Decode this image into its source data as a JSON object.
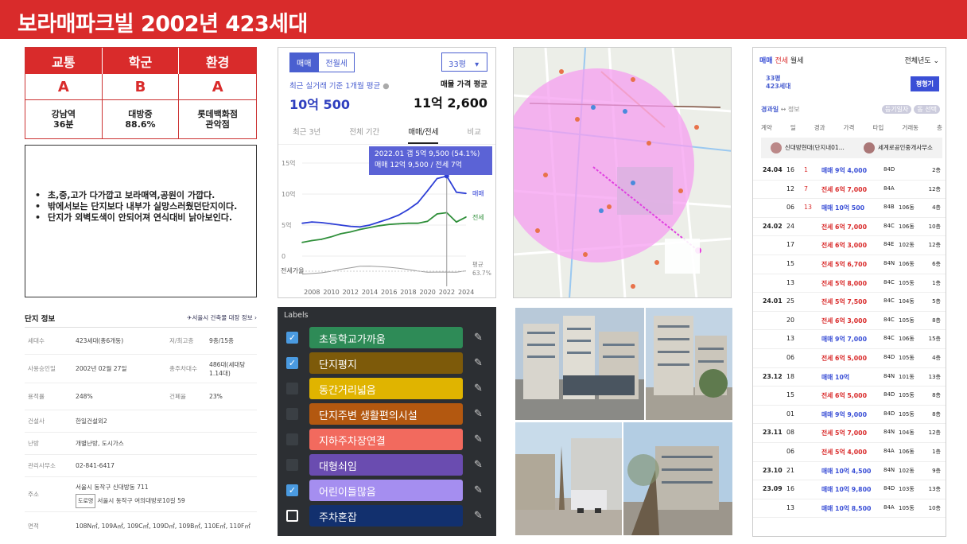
{
  "title": "보라매파크빌  2002년 423세대",
  "grade": {
    "headers": [
      "교통",
      "학군",
      "환경"
    ],
    "grades": [
      "A",
      "B",
      "A"
    ],
    "details": [
      "강남역\n36분",
      "대방중\n88.6%",
      "롯데백화점\n관악점"
    ]
  },
  "notes": [
    "초,중,고가 다가깝고 보라매역,공원이 가깝다.",
    "밖에서보는 단지보다 내부가 실망스러웠던단지이다.",
    "단지가 외벽도색이 안되어져 연식대비 낡아보인다."
  ],
  "info": {
    "title": "단지 정보",
    "link": "서울시 건축물 대장 정보",
    "rows": [
      {
        "k": "세대수",
        "v": "423세대(총6개동)",
        "k2": "저/최고층",
        "v2": "9층/15층"
      },
      {
        "k": "사용승인일",
        "v": "2002년 02월 27일",
        "k2": "총주차대수",
        "v2": "486대(세대당 1.14대)"
      },
      {
        "k": "용적률",
        "v": "248%",
        "k2": "건폐율",
        "v2": "23%"
      },
      {
        "k": "건설사",
        "v": "한일건설외2"
      },
      {
        "k": "난방",
        "v": "개별난방, 도시가스"
      },
      {
        "k": "관리사무소",
        "v": "02-841-6417"
      },
      {
        "k": "주소",
        "v": "서울시 동작구 신대방동 711",
        "tag": "도로명",
        "v3": "서울시 동작구 여의대방로10길 59"
      },
      {
        "k": "면적",
        "v": "108N㎡, 109A㎡, 109C㎡, 109D㎡, 109B㎡, 110E㎡, 110F㎡"
      }
    ]
  },
  "price": {
    "seg_on": "매매",
    "seg_off": "전월세",
    "size": "33평",
    "recent_label": "최근 실거래 기준 1개월 평균",
    "recent_value": "10억 500",
    "ask_label": "매물 가격 평균",
    "ask_value": "11억 2,600",
    "tabs": [
      "최근 3년",
      "전체 기간",
      "매매/전세",
      "비교"
    ],
    "tooltip1": "2022.01  갭 5억 9,500 (54.1%)",
    "tooltip2": "매매 12억 9,500 / 전세 7억",
    "lbl_sale": "매매",
    "lbl_lease": "전세",
    "lbl_ratio": "전세가율",
    "lbl_avg": "평균",
    "lbl_avg_v": "63.7%"
  },
  "chart_data": {
    "type": "line",
    "x": [
      2007,
      2008,
      2009,
      2010,
      2011,
      2012,
      2013,
      2014,
      2015,
      2016,
      2017,
      2018,
      2019,
      2020,
      2021,
      2022,
      2023,
      2024
    ],
    "series": [
      {
        "name": "매매",
        "values": [
          5.3,
          5.5,
          5.4,
          5.2,
          5.0,
          4.8,
          4.7,
          5.0,
          5.5,
          6.0,
          6.6,
          7.5,
          8.6,
          10.5,
          12.5,
          12.9,
          10.3,
          10.1
        ]
      },
      {
        "name": "전세",
        "values": [
          2.2,
          2.5,
          2.7,
          3.1,
          3.6,
          3.9,
          4.3,
          4.6,
          4.9,
          5.1,
          5.2,
          5.3,
          5.3,
          5.6,
          6.8,
          7.0,
          5.5,
          6.3
        ]
      }
    ],
    "yticks": [
      "0",
      "5억",
      "10억",
      "15억"
    ],
    "xticks": [
      "2008",
      "2010",
      "2012",
      "2014",
      "2016",
      "2018",
      "2020",
      "2022",
      "2024"
    ],
    "ylim": [
      0,
      15
    ],
    "highlight_x": 2022
  },
  "labels": {
    "title": "Labels",
    "items": [
      {
        "text": "초등학교가까움",
        "color": "#2e8b57",
        "checked": true
      },
      {
        "text": "단지평지",
        "color": "#7d5a0a",
        "checked": true
      },
      {
        "text": "동간거리넓음",
        "color": "#e0b400",
        "checked": false
      },
      {
        "text": "단지주변 생활편의시설",
        "color": "#b35810",
        "checked": false
      },
      {
        "text": "지하주차장연결",
        "color": "#f26a5e",
        "checked": false
      },
      {
        "text": "대형쇠임",
        "color": "#6a4cb0",
        "checked": false
      },
      {
        "text": "어린이들많음",
        "color": "#a58ef0",
        "checked": true
      },
      {
        "text": "주차혼잡",
        "color": "#12306e",
        "checked": false
      }
    ]
  },
  "listing": {
    "tab1": "매매",
    "tab2": "전세",
    "tab3": "월세",
    "filter": "전체년도",
    "apt": "33평\n423세대",
    "btn": "평형기",
    "sub_a": "경과일",
    "sub_b": "↔ 정보",
    "btn_a": "등기일자",
    "btn_b": "동 선택",
    "cols": [
      "계약",
      "일",
      "경과",
      "가격",
      "타입",
      "거래동",
      "층"
    ],
    "agent1": "신대방현대(단지내01...",
    "agent2": "세계로공인중개사무소",
    "rows": [
      {
        "ym": "24.04",
        "d": "16",
        "f": "1",
        "p": "매매 9억 4,000",
        "s": "sale",
        "t": "84D",
        "b": "",
        "fl": "2층"
      },
      {
        "ym": "",
        "d": "12",
        "f": "7",
        "p": "전세 6억 7,000",
        "s": "lease",
        "t": "84A",
        "b": "",
        "fl": "12층"
      },
      {
        "ym": "",
        "d": "06",
        "f": "13",
        "p": "매매 10억 500",
        "s": "sale",
        "t": "84B",
        "b": "106동",
        "fl": "4층"
      },
      {
        "ym": "24.02",
        "d": "24",
        "f": "",
        "p": "전세 6억 7,000",
        "s": "lease",
        "t": "84C",
        "b": "106동",
        "fl": "10층"
      },
      {
        "ym": "",
        "d": "17",
        "f": "",
        "p": "전세 6억 3,000",
        "s": "lease",
        "t": "84E",
        "b": "102동",
        "fl": "12층"
      },
      {
        "ym": "",
        "d": "15",
        "f": "",
        "p": "전세 5억 6,700",
        "s": "lease",
        "t": "84N",
        "b": "106동",
        "fl": "6층"
      },
      {
        "ym": "",
        "d": "13",
        "f": "",
        "p": "전세 5억 8,000",
        "s": "lease",
        "t": "84C",
        "b": "105동",
        "fl": "1층"
      },
      {
        "ym": "24.01",
        "d": "25",
        "f": "",
        "p": "전세 5억 7,500",
        "s": "lease",
        "t": "84C",
        "b": "104동",
        "fl": "5층"
      },
      {
        "ym": "",
        "d": "20",
        "f": "",
        "p": "전세 6억 3,000",
        "s": "lease",
        "t": "84C",
        "b": "105동",
        "fl": "8층"
      },
      {
        "ym": "",
        "d": "13",
        "f": "",
        "p": "매매 9억 7,000",
        "s": "sale",
        "t": "84C",
        "b": "106동",
        "fl": "15층"
      },
      {
        "ym": "",
        "d": "06",
        "f": "",
        "p": "전세 6억 5,000",
        "s": "lease",
        "t": "84D",
        "b": "105동",
        "fl": "4층"
      },
      {
        "ym": "23.12",
        "d": "18",
        "f": "",
        "p": "매매 10억",
        "s": "sale",
        "t": "84N",
        "b": "101동",
        "fl": "13층"
      },
      {
        "ym": "",
        "d": "15",
        "f": "",
        "p": "전세 6억 5,000",
        "s": "lease",
        "t": "84D",
        "b": "105동",
        "fl": "8층"
      },
      {
        "ym": "",
        "d": "01",
        "f": "",
        "p": "매매 9억 9,000",
        "s": "sale",
        "t": "84D",
        "b": "105동",
        "fl": "8층"
      },
      {
        "ym": "23.11",
        "d": "08",
        "f": "",
        "p": "전세 5억 7,000",
        "s": "lease",
        "t": "84N",
        "b": "104동",
        "fl": "12층"
      },
      {
        "ym": "",
        "d": "06",
        "f": "",
        "p": "전세 5억 4,000",
        "s": "lease",
        "t": "84A",
        "b": "106동",
        "fl": "1층"
      },
      {
        "ym": "23.10",
        "d": "21",
        "f": "",
        "p": "매매 10억 4,500",
        "s": "sale",
        "t": "84N",
        "b": "102동",
        "fl": "9층"
      },
      {
        "ym": "23.09",
        "d": "16",
        "f": "",
        "p": "매매 10억 9,800",
        "s": "sale",
        "t": "84D",
        "b": "103동",
        "fl": "13층"
      },
      {
        "ym": "",
        "d": "13",
        "f": "",
        "p": "매매 10억 8,500",
        "s": "sale",
        "t": "84A",
        "b": "105동",
        "fl": "10층"
      }
    ]
  }
}
